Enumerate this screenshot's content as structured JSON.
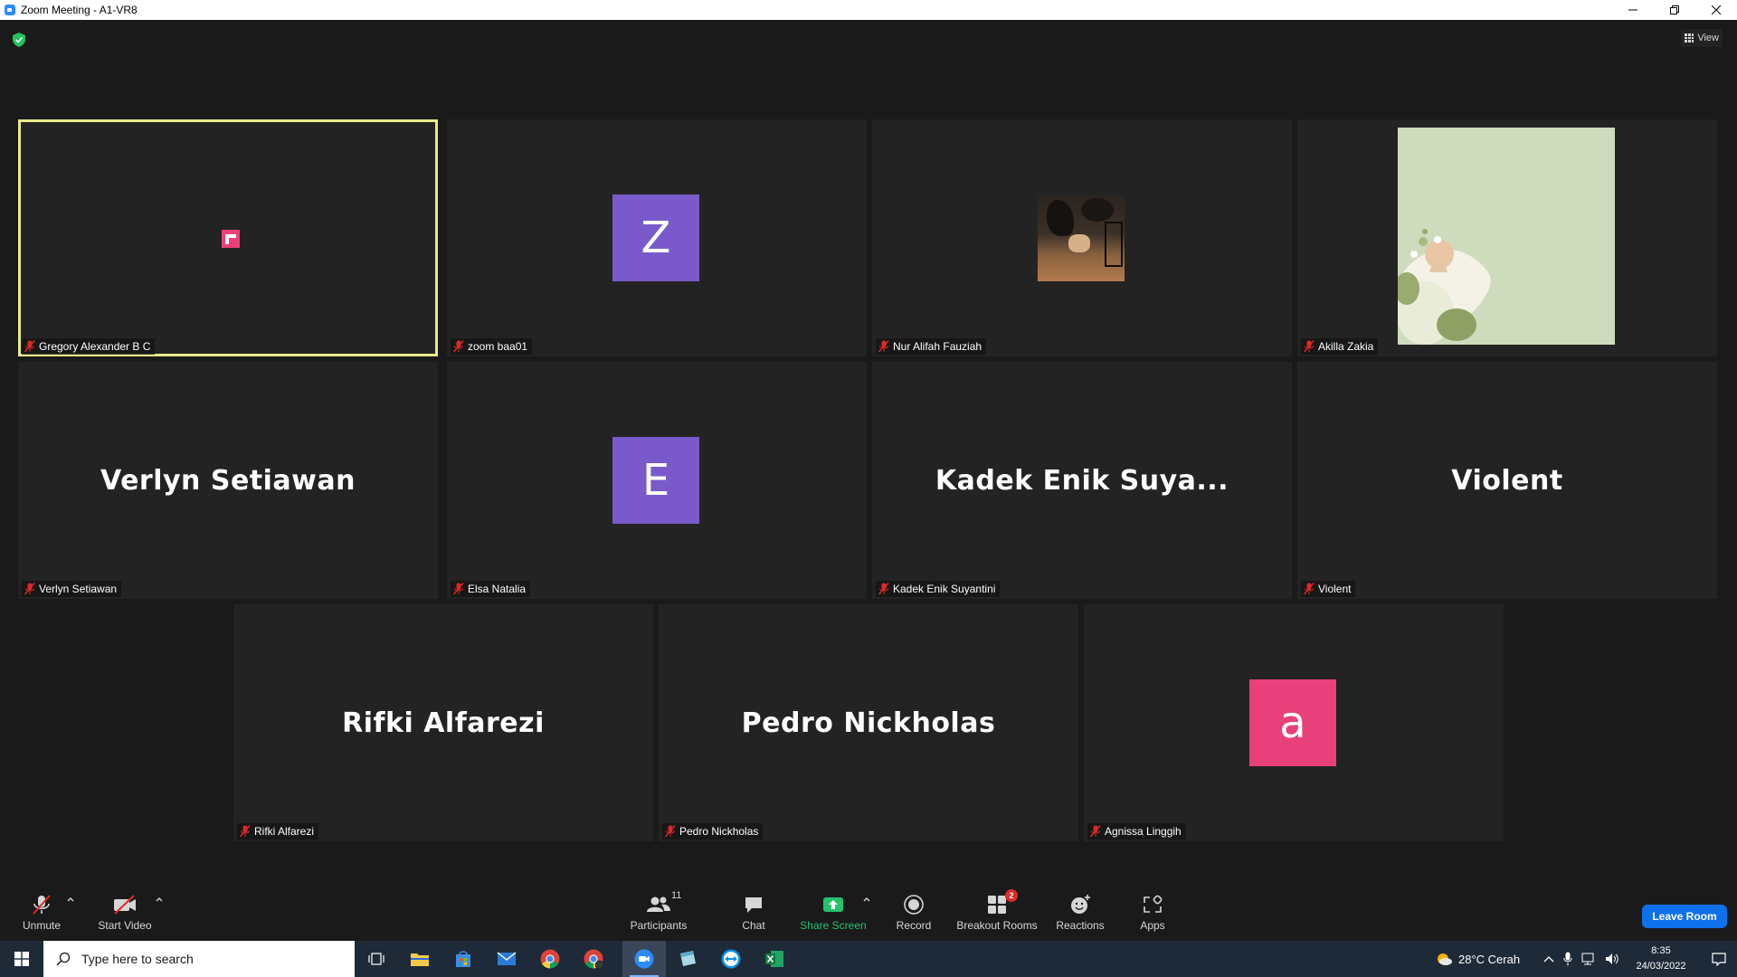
{
  "window": {
    "title": "Zoom Meeting - A1-VR8"
  },
  "header": {
    "view_label": "View"
  },
  "tiles": [
    {
      "name": "Gregory Alexander B C",
      "display": "image",
      "active": true
    },
    {
      "name": "zoom baa01",
      "display": "letter",
      "letter": "Z",
      "color": "#7a5acb"
    },
    {
      "name": "Nur Alifah Fauziah",
      "display": "photo"
    },
    {
      "name": "Akilla Zakia",
      "display": "illustration"
    },
    {
      "name": "Verlyn Setiawan",
      "display": "text",
      "big": "Verlyn Setiawan"
    },
    {
      "name": "Elsa Natalia",
      "display": "letter",
      "letter": "E",
      "color": "#7a5acb"
    },
    {
      "name": "Kadek Enik Suyantini",
      "display": "text",
      "big": "Kadek Enik Suya..."
    },
    {
      "name": "Violent",
      "display": "text",
      "big": "Violent"
    },
    {
      "name": "Rifki Alfarezi",
      "display": "text",
      "big": "Rifki Alfarezi"
    },
    {
      "name": "Pedro Nickholas",
      "display": "text",
      "big": "Pedro Nickholas"
    },
    {
      "name": "Agnissa Linggih",
      "display": "letter",
      "letter": "a",
      "color": "#e8407a"
    }
  ],
  "toolbar": {
    "unmute": "Unmute",
    "start_video": "Start Video",
    "participants": "Participants",
    "participants_count": "11",
    "chat": "Chat",
    "share_screen": "Share Screen",
    "record": "Record",
    "breakout_rooms": "Breakout Rooms",
    "breakout_badge": "2",
    "reactions": "Reactions",
    "apps": "Apps",
    "leave": "Leave Room"
  },
  "taskbar": {
    "search_placeholder": "Type here to search",
    "weather": "28°C  Cerah",
    "time": "8:35",
    "date": "24/03/2022"
  },
  "colors": {
    "accent": "#0e71eb",
    "share_green": "#25c26e",
    "active_speaker": "#e9e98a",
    "muted_red": "#e02828"
  }
}
